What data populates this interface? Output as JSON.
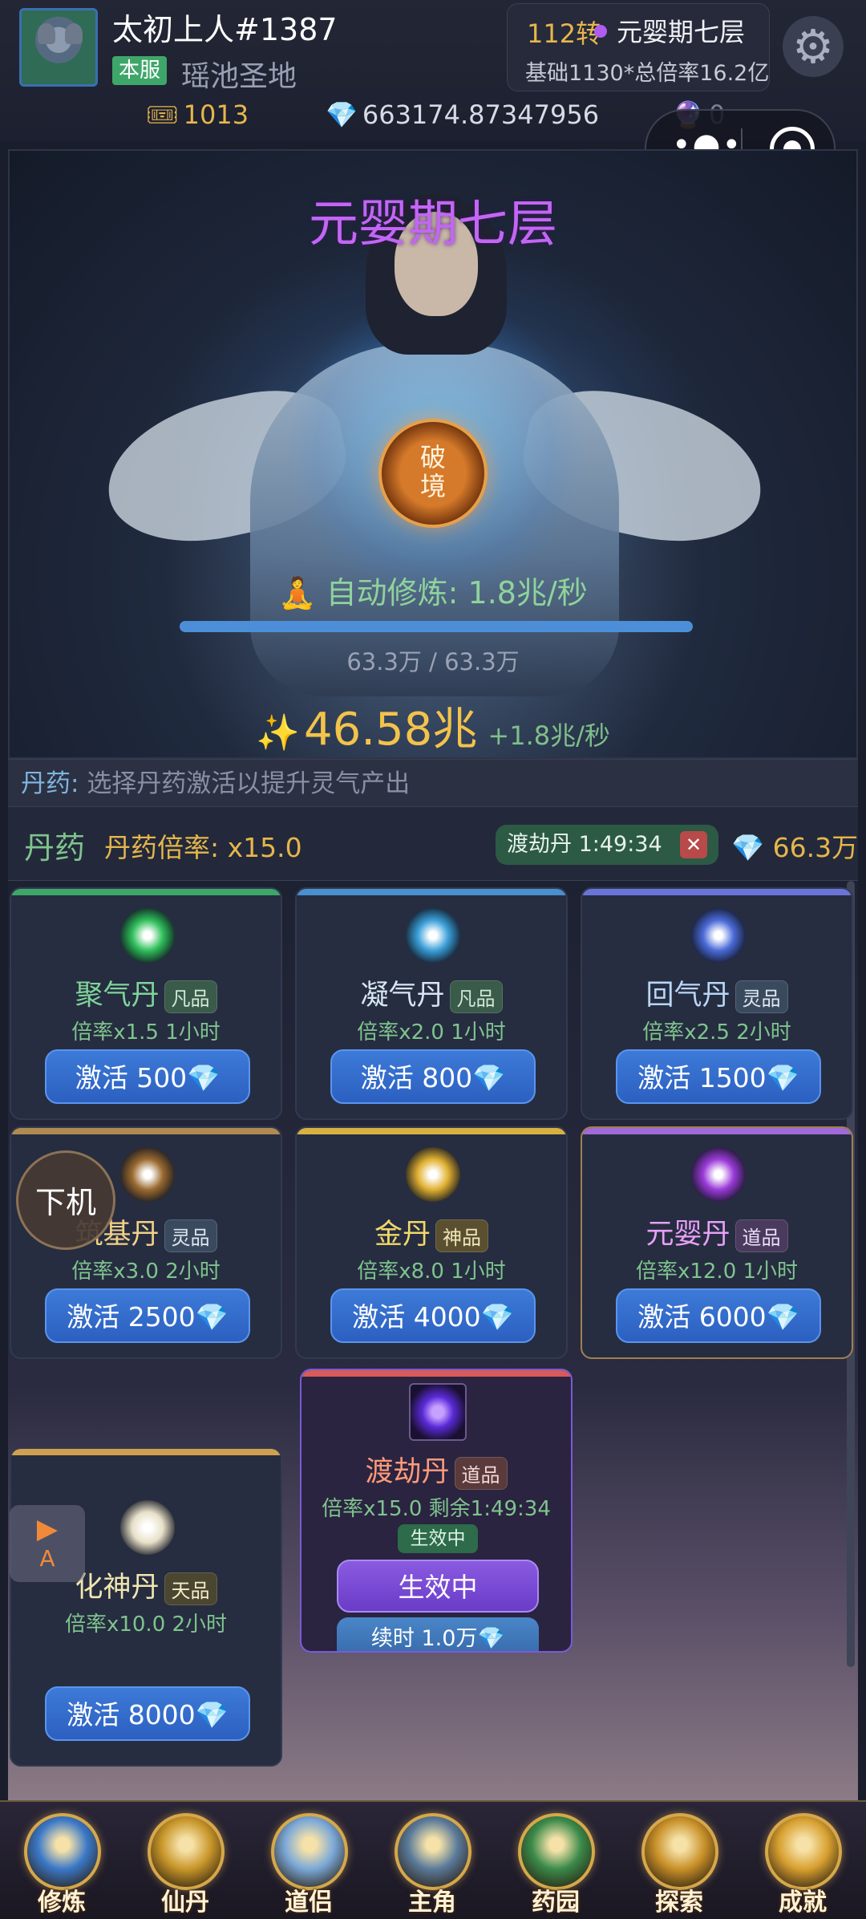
{
  "header": {
    "player_name": "太初上人#1387",
    "server_badge": "本服",
    "server_name": "瑶池圣地",
    "realm_turn": "112转",
    "realm_level": "元婴期七层",
    "realm_stats": "基础1130*总倍率16.2亿",
    "resources": {
      "tickets": "1013",
      "gems": "663174.87347956",
      "orbs": "0"
    }
  },
  "hero": {
    "realm_title": "元婴期七层",
    "breakthrough_line1": "破",
    "breakthrough_line2": "境",
    "auto_cultivation": "自动修炼: 1.8兆/秒",
    "progress_text": "63.3万 / 63.3万",
    "progress_fraction": 1.0,
    "qi_total": "46.58兆",
    "qi_rate": "+1.8兆/秒"
  },
  "hint": {
    "label": "丹药:",
    "text": "选择丹药激活以提升灵气产出"
  },
  "pill_bar": {
    "title": "丹药",
    "multiplier": "丹药倍率: x15.0",
    "active_chip": "渡劫丹 1:49:34",
    "close": "✕",
    "gem_balance": "66.3万"
  },
  "pills": [
    {
      "name": "聚气丹",
      "grade": "凡品",
      "mult": "倍率x1.5 1小时",
      "button": "激活 500",
      "bar": "#3fa66a",
      "icon": "green-swirl-pill-icon",
      "icon_color": "#2fbf5a"
    },
    {
      "name": "凝气丹",
      "grade": "凡品",
      "mult": "倍率x2.0 1小时",
      "button": "激活 800",
      "bar": "#4a8fd0",
      "icon": "blue-ring-pill-icon",
      "icon_color": "#3a9fd8"
    },
    {
      "name": "回气丹",
      "grade": "灵品",
      "mult": "倍率x2.5 2小时",
      "button": "激活 1500",
      "bar": "#6a74d8",
      "icon": "blue-vortex-pill-icon",
      "icon_color": "#4a6ad8"
    },
    {
      "name": "筑基丹",
      "grade": "灵品",
      "mult": "倍率x3.0 2小时",
      "button": "激活 2500",
      "bar": "#b08a50",
      "icon": "bronze-seal-pill-icon",
      "icon_color": "#9a6a30"
    },
    {
      "name": "金丹",
      "grade": "神品",
      "mult": "倍率x8.0 1小时",
      "button": "激活 4000",
      "bar": "#d8b040",
      "icon": "golden-orb-pill-icon",
      "icon_color": "#e0b030"
    },
    {
      "name": "元婴丹",
      "grade": "道品",
      "mult": "倍率x12.0 1小时",
      "button": "激活 6000",
      "bar": "#a06ad8",
      "icon": "purple-vortex-pill-icon",
      "icon_color": "#9a3ad8"
    },
    {
      "name": "化神丹",
      "grade": "天品",
      "mult": "倍率x10.0 2小时",
      "button": "激活 8000",
      "bar": "#d0a050",
      "icon": "white-light-pill-icon",
      "icon_color": "#e8e0c8"
    }
  ],
  "featured_pill": {
    "name": "渡劫丹",
    "grade": "道品",
    "mult": "倍率x15.0 剩余1:49:34",
    "badge": "生效中",
    "button": "生效中",
    "extend": "续时 1.0万",
    "bar": "#d85a5a",
    "icon": "lightning-vortex-pill-icon"
  },
  "floating": {
    "offline": "下机",
    "play_letter": "A"
  },
  "nav": [
    {
      "label": "修炼",
      "color": "#3a78c8"
    },
    {
      "label": "仙丹",
      "color": "#c8962a"
    },
    {
      "label": "道侣",
      "color": "#7aa8d8"
    },
    {
      "label": "主角",
      "color": "#5a7a9a"
    },
    {
      "label": "药园",
      "color": "#3a8a4a"
    },
    {
      "label": "探索",
      "color": "#c89028"
    },
    {
      "label": "成就",
      "color": "#d8a030"
    }
  ]
}
